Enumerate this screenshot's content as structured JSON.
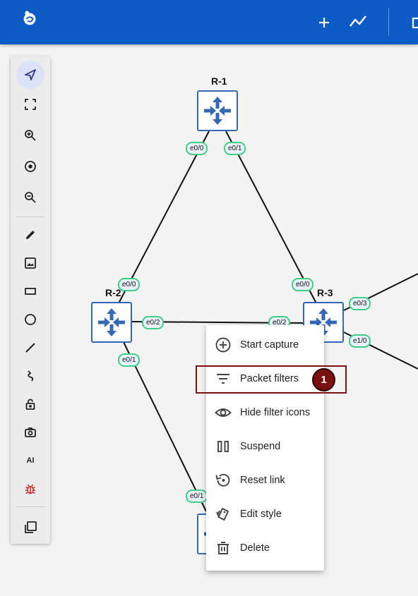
{
  "topbar": {
    "logo_icon": "gns3-logo-icon",
    "add_icon": "plus-icon",
    "stats_icon": "chart-line-icon",
    "window_icon": "window-icon"
  },
  "tools": [
    {
      "name": "select-tool",
      "icon": "navigation-arrow-icon",
      "active": true
    },
    {
      "name": "fit-to-screen",
      "icon": "fit-screen-icon"
    },
    {
      "name": "zoom-in",
      "icon": "zoom-in-icon"
    },
    {
      "name": "reset-zoom",
      "icon": "center-target-icon"
    },
    {
      "name": "zoom-out",
      "icon": "zoom-out-icon"
    },
    {
      "name": "draw-pencil",
      "icon": "pencil-icon"
    },
    {
      "name": "add-image",
      "icon": "image-icon"
    },
    {
      "name": "draw-rectangle",
      "icon": "rectangle-icon"
    },
    {
      "name": "draw-ellipse",
      "icon": "circle-icon"
    },
    {
      "name": "draw-line",
      "icon": "line-icon"
    },
    {
      "name": "draw-curve",
      "icon": "curve-icon"
    },
    {
      "name": "lock-items",
      "icon": "lock-open-icon"
    },
    {
      "name": "screenshot",
      "icon": "camera-icon"
    },
    {
      "name": "ai-assistant",
      "icon": "ai-icon",
      "label": "AI"
    },
    {
      "name": "debug",
      "icon": "bug-icon"
    },
    {
      "name": "console",
      "icon": "copy-icon"
    }
  ],
  "nodes": {
    "r1": {
      "label": "R-1"
    },
    "r2": {
      "label": "R-2"
    },
    "r3": {
      "label": "R-3"
    }
  },
  "interfaces": {
    "r1_e00": "e0/0",
    "r1_e01": "e0/1",
    "r2_e00": "e0/0",
    "r2_e02": "e0/2",
    "r2_e01": "e0/1",
    "r3_e00": "e0/0",
    "r3_e02": "e0/2",
    "r3_e03": "e0/3",
    "r3_e10": "e1/0",
    "r4_e01": "e0/1"
  },
  "context_menu": {
    "items": [
      {
        "label": "Start capture",
        "icon": "plus-circle-icon"
      },
      {
        "label": "Packet filters",
        "icon": "filter-list-icon"
      },
      {
        "label": "Hide filter icons",
        "icon": "eye-icon"
      },
      {
        "label": "Suspend",
        "icon": "pause-icon"
      },
      {
        "label": "Reset link",
        "icon": "reset-icon"
      },
      {
        "label": "Edit style",
        "icon": "style-icon"
      },
      {
        "label": "Delete",
        "icon": "trash-icon"
      }
    ]
  },
  "annotation": {
    "step": "1",
    "color": "#7a1010"
  },
  "colors": {
    "header": "#0d5bc4",
    "link_tag_border": "#3ecf84",
    "router_border": "#3468b5"
  }
}
